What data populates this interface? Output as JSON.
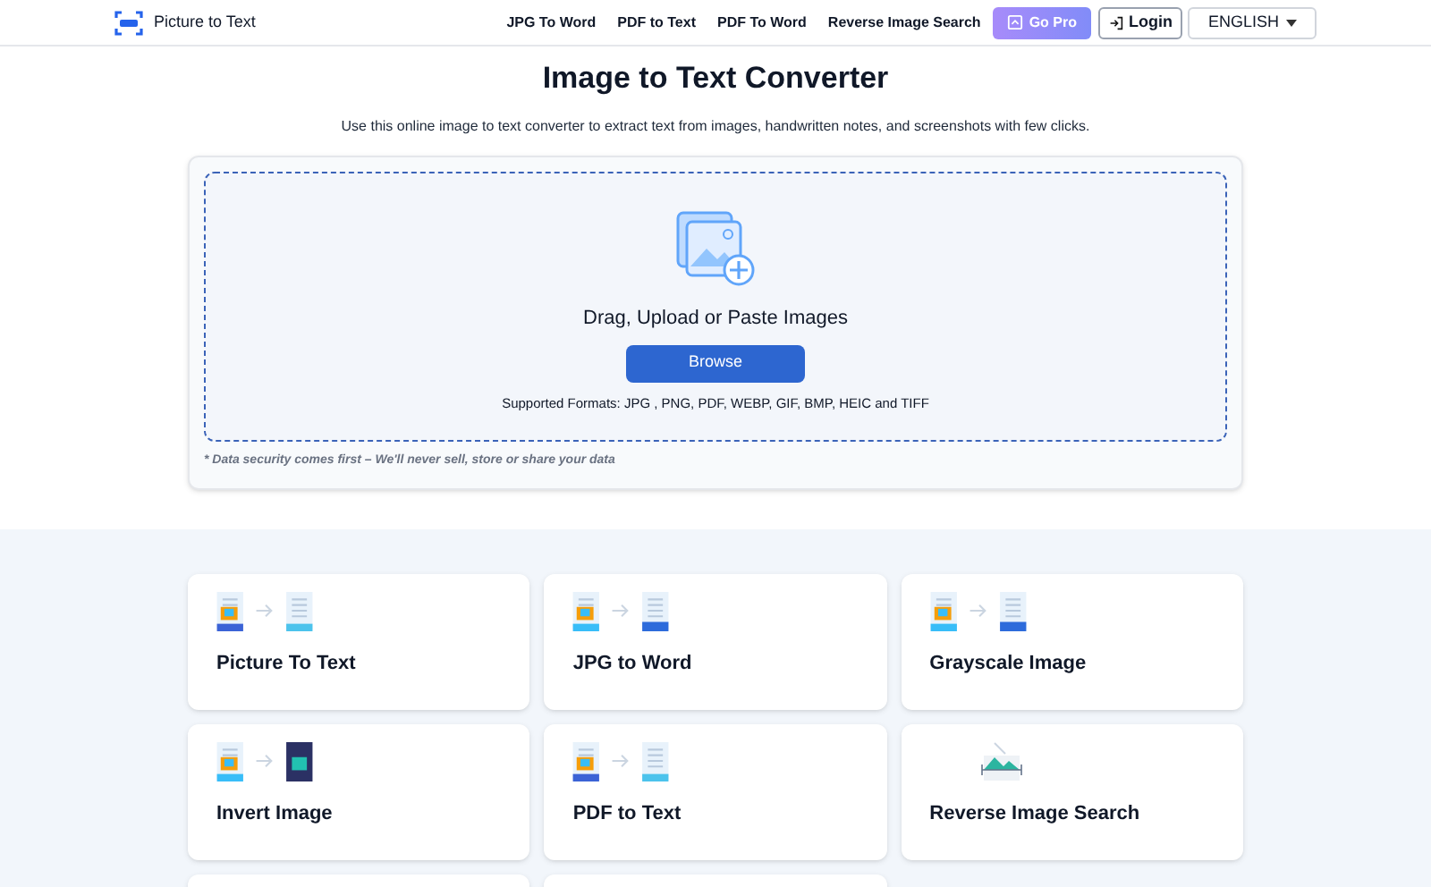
{
  "header": {
    "brand": "Picture to Text",
    "nav": [
      "JPG To Word",
      "PDF to Text",
      "PDF To Word",
      "Reverse Image Search"
    ],
    "go_pro": "Go Pro",
    "login": "Login",
    "language": "ENGLISH"
  },
  "hero": {
    "title": "Image to Text Converter",
    "subtitle": "Use this online image to text converter to extract text from images, handwritten notes, and screenshots with few clicks."
  },
  "upload": {
    "prompt": "Drag, Upload or Paste Images",
    "button": "Browse",
    "formats": "Supported Formats: JPG , PNG, PDF, WEBP, GIF, BMP, HEIC and TIFF",
    "note": "* Data security comes first – We'll never sell, store or share your data"
  },
  "tools": [
    {
      "kind": "image_txt",
      "title": "Picture To Text"
    },
    {
      "kind": "jpg_doc",
      "title": "JPG to Word"
    },
    {
      "kind": "jpg_doc",
      "title": "Grayscale Image"
    },
    {
      "kind": "jpg_dark",
      "title": "Invert Image"
    },
    {
      "kind": "image_txt",
      "title": "PDF to Text"
    },
    {
      "kind": "search",
      "title": "Reverse Image Search"
    },
    {
      "kind": "cut_off"
    },
    {
      "kind": "cut_off"
    }
  ]
}
